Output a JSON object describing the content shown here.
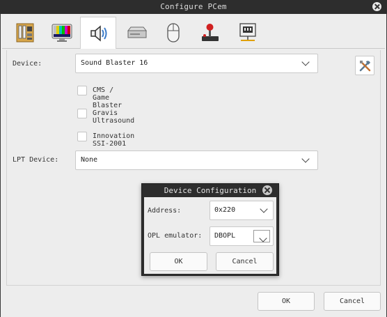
{
  "window": {
    "title": "Configure PCem"
  },
  "toolbar": {
    "icons": [
      "motherboard-icon",
      "display-icon",
      "speaker-icon",
      "drive-icon",
      "mouse-icon",
      "joystick-icon",
      "network-icon"
    ],
    "active": "speaker-icon"
  },
  "sound": {
    "device_label": "Device:",
    "device_value": "Sound Blaster 16",
    "options": [
      {
        "label": "CMS / Game Blaster",
        "checked": false
      },
      {
        "label": "Gravis Ultrasound",
        "checked": false
      },
      {
        "label": "Innovation SSI-2001",
        "checked": false
      }
    ],
    "lpt_label": "LPT Device:",
    "lpt_value": "None",
    "configure_icon": "tools-icon"
  },
  "device_config": {
    "title": "Device Configuration",
    "address_label": "Address:",
    "address_value": "0x220",
    "opl_label": "OPL emulator:",
    "opl_value": "DBOPL",
    "ok": "OK",
    "cancel": "Cancel"
  },
  "footer": {
    "ok": "OK",
    "cancel": "Cancel"
  },
  "colors": {
    "titlebar": "#2d2d2d",
    "background": "#ededed",
    "field": "#ffffff"
  }
}
